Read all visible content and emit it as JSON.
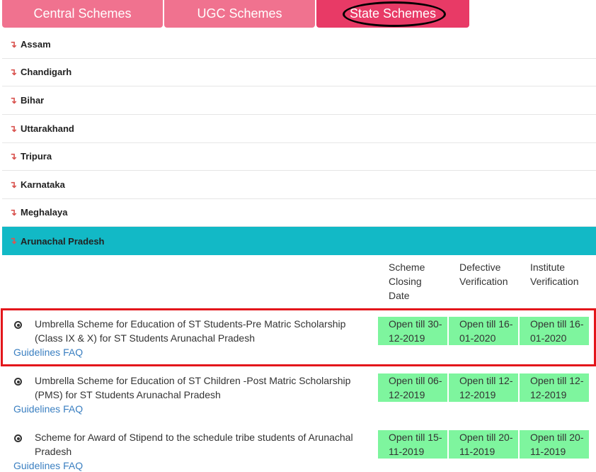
{
  "tabs": [
    {
      "label": "Central Schemes"
    },
    {
      "label": "UGC Schemes"
    },
    {
      "label": "State Schemes"
    }
  ],
  "states": [
    {
      "name": "Assam"
    },
    {
      "name": "Chandigarh"
    },
    {
      "name": "Bihar"
    },
    {
      "name": "Uttarakhand"
    },
    {
      "name": "Tripura"
    },
    {
      "name": "Karnataka"
    },
    {
      "name": "Meghalaya"
    },
    {
      "name": "Arunachal Pradesh"
    }
  ],
  "arrow_glyph": "↴",
  "header": {
    "closing": "Scheme Closing Date",
    "defective": "Defective Verification",
    "institute": "Institute Verification"
  },
  "schemes": [
    {
      "title": "Umbrella Scheme for Education of ST Students-Pre Matric Scholarship (Class IX & X) for ST Students Arunachal Pradesh",
      "guidelines": "Guidelines",
      "faq": "FAQ",
      "closing": "Open till 30-12-2019",
      "defective": "Open till 16-01-2020",
      "institute": "Open till 16-01-2020"
    },
    {
      "title": "Umbrella Scheme for Education of ST Children -Post Matric Scholarship (PMS) for ST Students Arunachal Pradesh",
      "guidelines": "Guidelines",
      "faq": "FAQ",
      "closing": "Open till 06-12-2019",
      "defective": "Open till 12-12-2019",
      "institute": "Open till 12-12-2019"
    },
    {
      "title": "Scheme for Award of Stipend to the schedule tribe students of Arunachal Pradesh",
      "guidelines": "Guidelines",
      "faq": "FAQ",
      "closing": "Open till 15-11-2019",
      "defective": "Open till 20-11-2019",
      "institute": "Open till 20-11-2019"
    }
  ],
  "colors": {
    "tab": "#f0728f",
    "tab_active": "#e83a66",
    "state_active": "#12b9c6",
    "date_cell": "#7ef59e",
    "highlight": "#e3161b",
    "link": "#3a7fc1"
  }
}
